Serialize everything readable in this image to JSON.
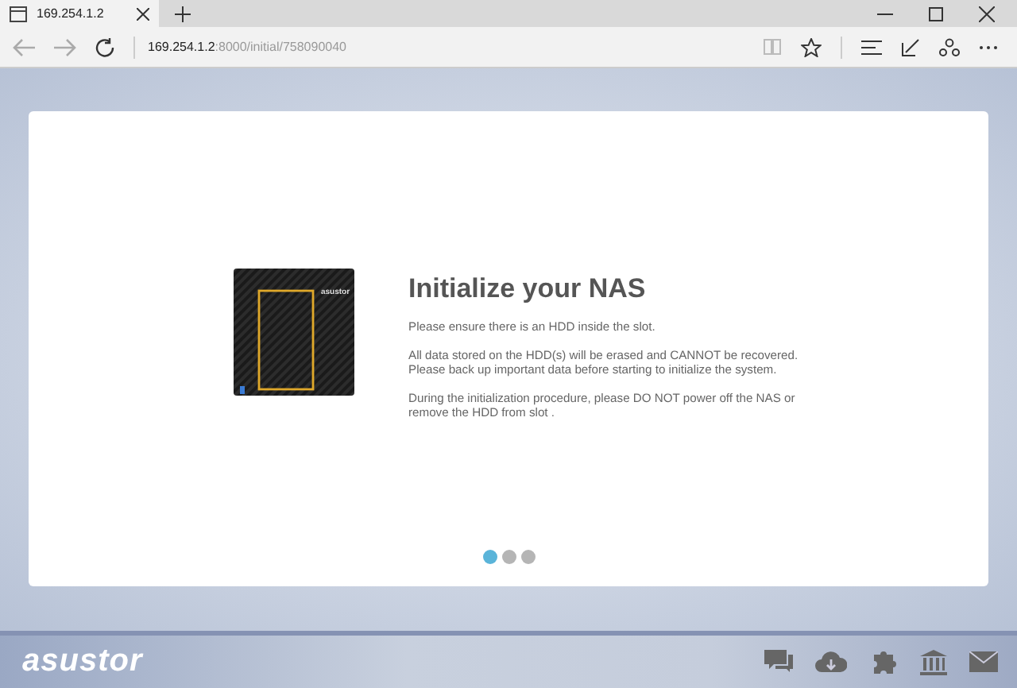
{
  "browser": {
    "tab": {
      "title": "169.254.1.2"
    },
    "address": {
      "host": "169.254.1.2",
      "path": ":8000/initial/758090040"
    }
  },
  "card": {
    "title": "Initialize your NAS",
    "paragraphs": [
      [
        "Please ensure there is an HDD inside the slot."
      ],
      [
        "All data stored on the HDD(s) will be erased and CANNOT be recovered.",
        "Please back up important data before starting to initialize the system."
      ],
      [
        "During the initialization procedure, please DO NOT power off the NAS or remove the HDD from slot ."
      ]
    ],
    "device_label": "asustor",
    "dots": [
      {
        "selected": true
      },
      {
        "selected": false
      },
      {
        "selected": false
      }
    ]
  },
  "footer": {
    "logo": "asustor"
  }
}
